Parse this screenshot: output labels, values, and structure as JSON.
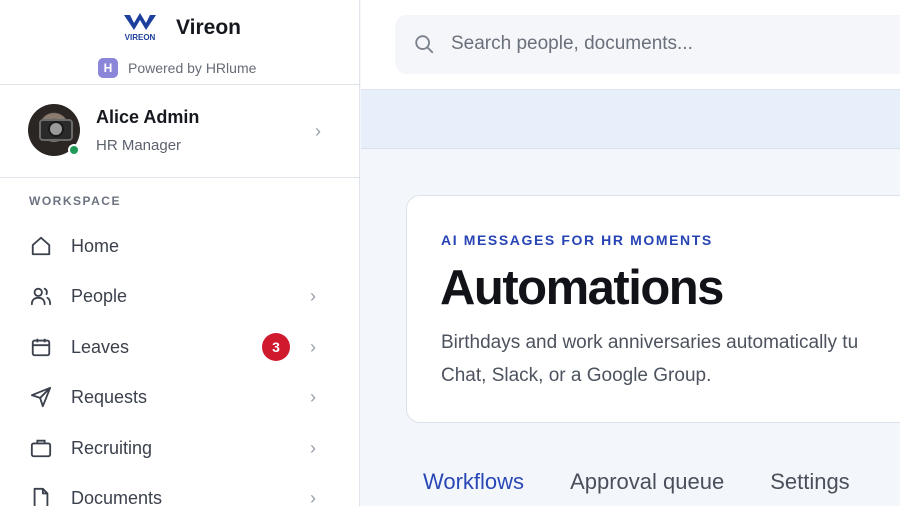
{
  "brand": {
    "name": "Vireon",
    "logo_text": "VIREON",
    "powered_by": "Powered by HRlume"
  },
  "user": {
    "name": "Alice Admin",
    "role": "HR Manager",
    "status": "online"
  },
  "sidebar": {
    "section": "WORKSPACE",
    "items": [
      {
        "label": "Home",
        "icon": "home-icon"
      },
      {
        "label": "People",
        "icon": "people-icon"
      },
      {
        "label": "Leaves",
        "icon": "calendar-icon",
        "badge": "3"
      },
      {
        "label": "Requests",
        "icon": "send-icon"
      },
      {
        "label": "Recruiting",
        "icon": "briefcase-icon"
      },
      {
        "label": "Documents",
        "icon": "document-icon"
      }
    ]
  },
  "search": {
    "placeholder": "Search people, documents..."
  },
  "card": {
    "eyebrow": "AI MESSAGES FOR HR MOMENTS",
    "title": "Automations",
    "desc_line1": "Birthdays and work anniversaries automatically tu",
    "desc_line2": "Chat, Slack, or a Google Group."
  },
  "tabs": {
    "workflows": "Workflows",
    "approval_queue": "Approval queue",
    "settings": "Settings",
    "active": "Workflows"
  },
  "colors": {
    "accent": "#2a48b5",
    "badge": "#d1192e",
    "online": "#1f9a55"
  }
}
